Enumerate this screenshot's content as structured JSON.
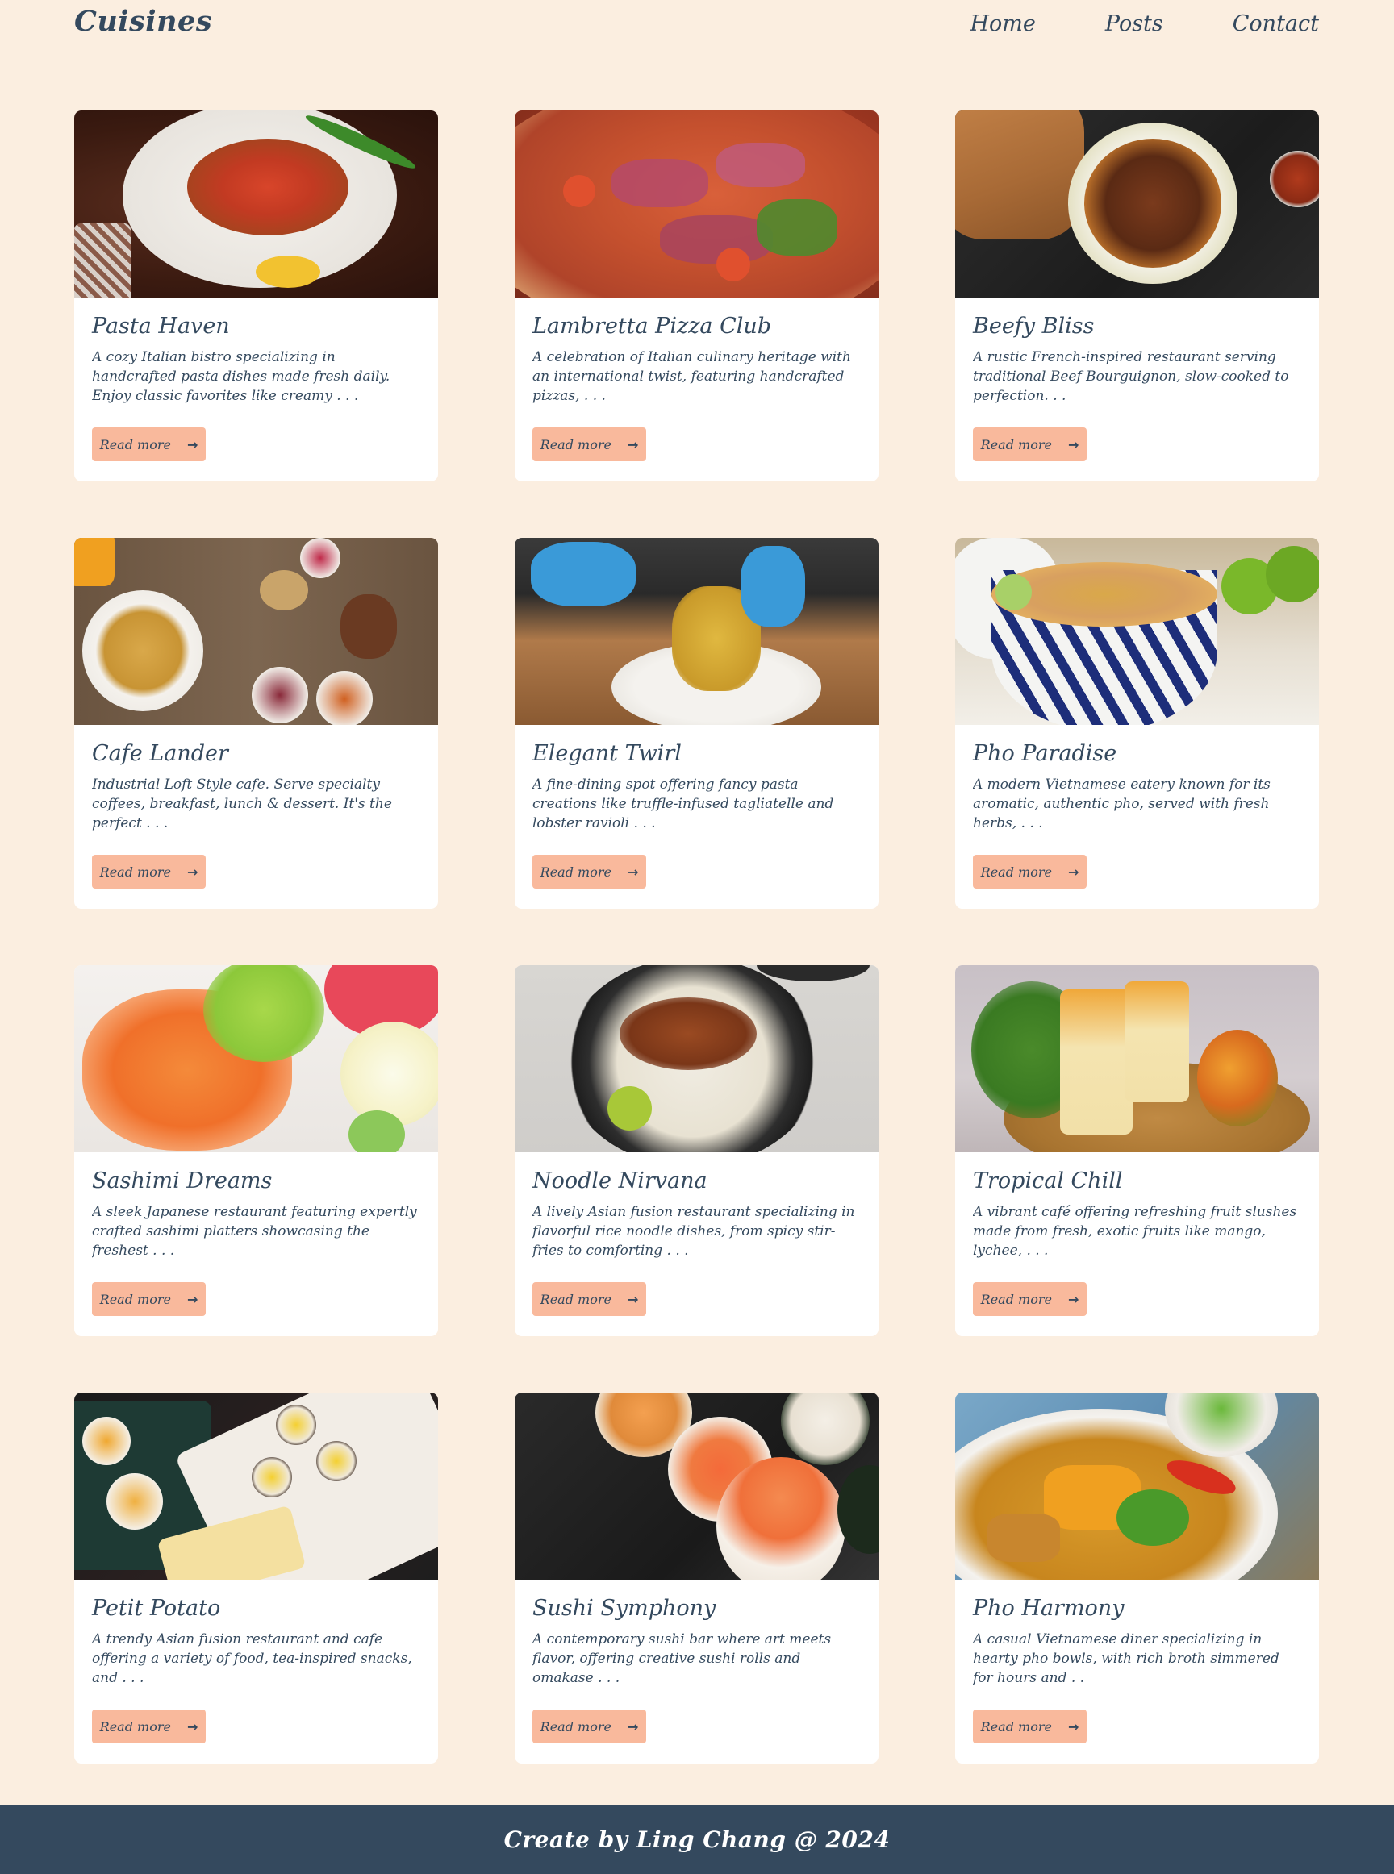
{
  "header": {
    "brand": "Cuisines",
    "nav": [
      "Home",
      "Posts",
      "Contact"
    ]
  },
  "cards": [
    {
      "title": "Pasta Haven",
      "description": "A cozy Italian bistro specializing in handcrafted pasta dishes made fresh daily. Enjoy classic favorites like creamy . . .",
      "button": "Read more",
      "image": "fajita-plate-photo"
    },
    {
      "title": "Lambretta Pizza Club",
      "description": "A celebration of Italian culinary heritage with an international twist, featuring handcrafted pizzas, . . .",
      "button": "Read more",
      "image": "prosciutto-pizza-photo"
    },
    {
      "title": "Beefy Bliss",
      "description": "A rustic French-inspired restaurant serving traditional Beef Bourguignon, slow-cooked to perfection. . .",
      "button": "Read more",
      "image": "beef-stew-photo"
    },
    {
      "title": "Cafe Lander",
      "description": "Industrial Loft Style cafe. Serve specialty coffees, breakfast, lunch & dessert. It's the perfect . . .",
      "button": "Read more",
      "image": "breakfast-table-photo"
    },
    {
      "title": "Elegant Twirl",
      "description": "A fine-dining spot offering fancy pasta creations like truffle-infused tagliatelle and lobster ravioli . . .",
      "button": "Read more",
      "image": "pasta-twirl-photo"
    },
    {
      "title": "Pho Paradise",
      "description": "A modern Vietnamese eatery known for its aromatic, authentic pho, served with fresh herbs, . . .",
      "button": "Read more",
      "image": "pho-bowl-photo"
    },
    {
      "title": "Sashimi Dreams",
      "description": "A sleek Japanese restaurant featuring expertly crafted sashimi platters showcasing the freshest . . .",
      "button": "Read more",
      "image": "sashimi-platter-photo"
    },
    {
      "title": "Noodle Nirvana",
      "description": "A lively Asian fusion restaurant specializing in flavorful rice noodle dishes, from spicy stir-fries to comforting . . .",
      "button": "Read more",
      "image": "meatball-noodles-photo"
    },
    {
      "title": "Tropical Chill",
      "description": "A vibrant café offering refreshing fruit slushes made from fresh, exotic fruits like mango, lychee, . . .",
      "button": "Read more",
      "image": "mango-drinks-photo"
    },
    {
      "title": "Petit Potato",
      "description": "A trendy Asian fusion restaurant and cafe offering a variety of food, tea-inspired snacks, and . . .",
      "button": "Read more",
      "image": "dessert-platter-photo"
    },
    {
      "title": "Sushi Symphony",
      "description": "A contemporary sushi bar where art meets flavor, offering creative sushi rolls and omakase . . .",
      "button": "Read more",
      "image": "sushi-rolls-photo"
    },
    {
      "title": "Pho Harmony",
      "description": "A casual Vietnamese diner specializing in hearty pho bowls, with rich broth simmered for hours and . .",
      "button": "Read more",
      "image": "vegetable-soup-photo"
    }
  ],
  "footer": {
    "text": "Create by Ling Chang @ 2024"
  },
  "colors": {
    "background": "#fbeee0",
    "text": "#34495e",
    "button": "#f9b99c",
    "footer": "#34495e"
  }
}
